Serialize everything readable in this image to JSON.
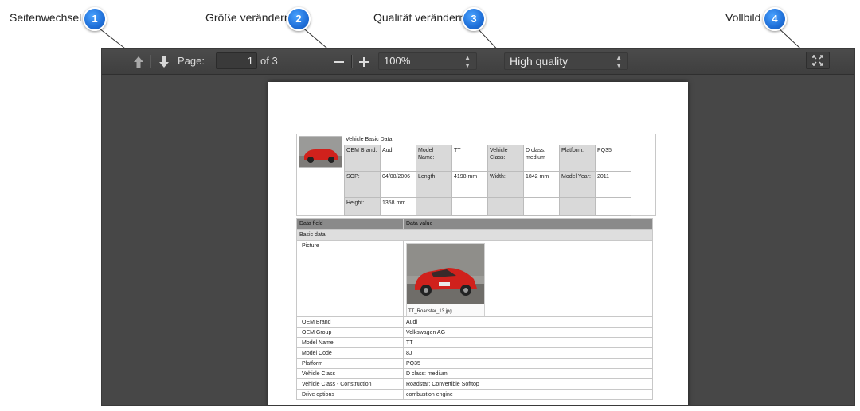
{
  "callouts": [
    {
      "label": "Seitenwechsel",
      "number": "1"
    },
    {
      "label": "Größe verändern",
      "number": "2"
    },
    {
      "label": "Qualität verändern",
      "number": "3"
    },
    {
      "label": "Vollbild",
      "number": "4"
    }
  ],
  "toolbar": {
    "page_label": "Page:",
    "page_value": "1",
    "page_of": "of 3",
    "zoom_value": "100%",
    "quality_value": "High quality",
    "prev_icon": "arrow-up-icon",
    "next_icon": "arrow-down-icon",
    "zoom_out_icon": "minus-icon",
    "zoom_in_icon": "plus-icon",
    "fullscreen_icon": "fullscreen-icon"
  },
  "document": {
    "basic_table": {
      "title": "Vehicle Basic Data",
      "rows": [
        [
          "OEM Brand:",
          "Audi",
          "Model Name:",
          "TT",
          "Vehicle Class:",
          "D class: medium",
          "Platform:",
          "PQ35"
        ],
        [
          "SOP:",
          "04/08/2006",
          "Length:",
          "4198 mm",
          "Width:",
          "1842 mm",
          "Model Year:",
          "2011"
        ],
        [
          "Height:",
          "1358 mm",
          "",
          "",
          "",
          "",
          "",
          ""
        ]
      ]
    },
    "data_table": {
      "headers": [
        "Data field",
        "Data value"
      ],
      "section": "Basic data",
      "picture_label": "Picture",
      "picture_caption": "TT_Roadstar_13.jpg",
      "rows": [
        [
          "OEM Brand",
          "Audi"
        ],
        [
          "OEM Group",
          "Volkswagen AG"
        ],
        [
          "Model Name",
          "TT"
        ],
        [
          "Model Code",
          "8J"
        ],
        [
          "Platform",
          "PQ35"
        ],
        [
          "Vehicle Class",
          "D class: medium"
        ],
        [
          "Vehicle Class - Construction",
          "Roadstar; Convertible Softtop"
        ],
        [
          "Drive options",
          "combustion engine"
        ]
      ]
    }
  },
  "colors": {
    "badge": "#1f6fd8",
    "viewer_bg": "#474747",
    "car_red": "#d0211c"
  }
}
